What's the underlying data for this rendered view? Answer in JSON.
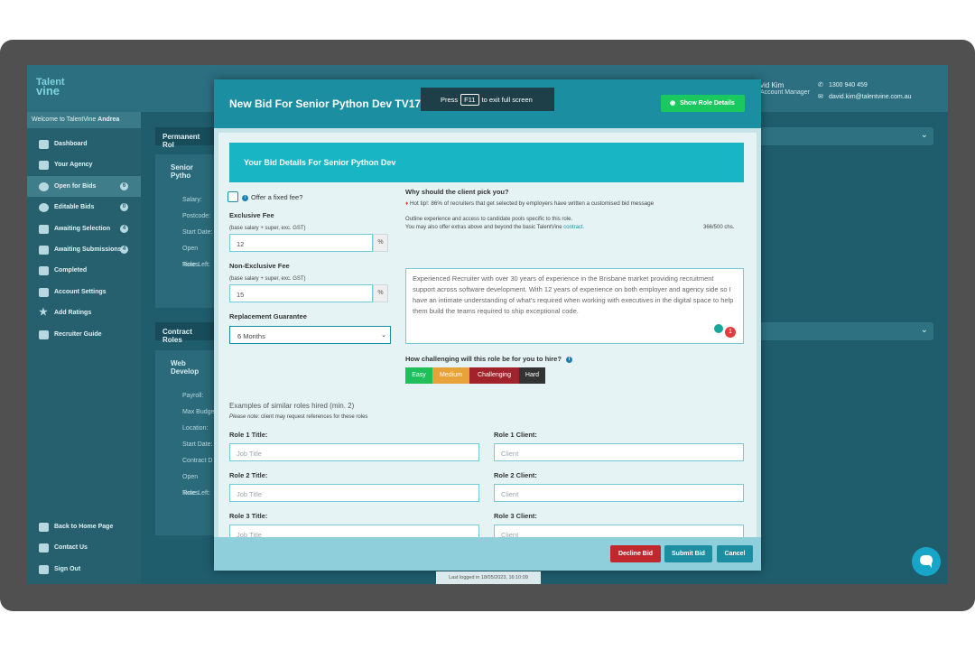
{
  "app": {
    "logo_line1": "Talent",
    "logo_line2": "vine"
  },
  "header": {
    "account_name": "vid Kim",
    "account_role": "Account Manager",
    "phone": "1300 940 459",
    "email": "david.kim@talentvine.com.au"
  },
  "sidebar": {
    "welcome_prefix": "Welcome to TalentVine",
    "welcome_name": "Andrea",
    "items": [
      {
        "label": "Dashboard",
        "badge": ""
      },
      {
        "label": "Your Agency",
        "badge": ""
      },
      {
        "label": "Open for Bids",
        "badge": "6"
      },
      {
        "label": "Editable Bids",
        "badge": "0"
      },
      {
        "label": "Awaiting Selection",
        "badge": "4"
      },
      {
        "label": "Awaiting Submissions",
        "badge": "4"
      },
      {
        "label": "Completed",
        "badge": ""
      },
      {
        "label": "Account Settings",
        "badge": ""
      },
      {
        "label": "Add Ratings",
        "badge": ""
      },
      {
        "label": "Recruiter Guide",
        "badge": ""
      }
    ],
    "bottom_items": [
      {
        "label": "Back to Home Page"
      },
      {
        "label": "Contact Us"
      },
      {
        "label": "Sign Out"
      }
    ]
  },
  "background": {
    "permanent_title": "Permanent Rol",
    "permanent_card_title": "Senior Pytho",
    "permanent_rows": [
      "Salary:",
      "Postcode:",
      "Start Date:",
      "Open Roles",
      "Time Left:"
    ],
    "contract_title": "Contract Roles",
    "contract_card_title": "Web Develop",
    "contract_rows": [
      "Payroll:",
      "Max Budge",
      "Location:",
      "Start Date:",
      "Contract D",
      "Open Roles",
      "Time Left:"
    ]
  },
  "modal": {
    "title": "New Bid For Senior Python Dev TV1729",
    "fullscreen_prefix": "Press",
    "fullscreen_key": "F11",
    "fullscreen_suffix": "to exit full screen",
    "show_role_details": "Show Role Details",
    "banner": "Your Bid Details For Senior Python Dev",
    "fixed_fee_label": "Offer a fixed fee?",
    "exclusive_fee_label": "Exclusive Fee",
    "exclusive_fee_note": "(base salary + super, exc. GST)",
    "exclusive_fee_value": "12",
    "nonexclusive_fee_label": "Non-Exclusive Fee",
    "nonexclusive_fee_note": "(base salary + super, exc. GST)",
    "nonexclusive_fee_value": "15",
    "percent": "%",
    "replacement_label": "Replacement Guarantee",
    "replacement_value": "6 Months",
    "why_label": "Why should the client pick you?",
    "hot_tip": "Hot tip!: 86% of recruiters that get selected by employers have written a customised bid message",
    "outline_note": "Outline experience and access to candidate pools specific to this role.",
    "extras_note": "You may also offer extras above and beyond the basic TalentVine",
    "contract_link": "contract.",
    "char_count": "366/500 chs.",
    "message": "Experienced Recruiter with over 30 years of experience in the Brisbane market providing recruitment support across software development. With 12 years of experience on both employer and agency side so I have an intimate understanding of what's required when working with executives in the digital space to help them build the teams required to ship exceptional code.",
    "challenge_label": "How challenging will this role be for you to hire?",
    "difficulty": [
      {
        "label": "Easy",
        "color": "#1fbf5b"
      },
      {
        "label": "Medium",
        "color": "#e8a23a"
      },
      {
        "label": "Challenging",
        "color": "#a0222a"
      },
      {
        "label": "Hard",
        "color": "#333333"
      }
    ],
    "examples_label": "Examples of similar roles hired (min. 2)",
    "examples_note_bold": "Please note:",
    "examples_note": "client may request references for these roles",
    "roles": [
      {
        "title_label": "Role 1 Title:",
        "client_label": "Role 1 Client:",
        "title_placeholder": "Job Title",
        "client_placeholder": "Client"
      },
      {
        "title_label": "Role 2 Title:",
        "client_label": "Role 2 Client:",
        "title_placeholder": "Job Title",
        "client_placeholder": "Client"
      },
      {
        "title_label": "Role 3 Title:",
        "client_label": "Role 3 Client:",
        "title_placeholder": "Job Title",
        "client_placeholder": "Client"
      }
    ],
    "decline_label": "Decline Bid",
    "submit_label": "Submit Bid",
    "cancel_label": "Cancel"
  },
  "footer": {
    "last_logged": "Last logged in 18/05/2023, 16:10:09"
  },
  "colors": {
    "accent": "#1c8ea2",
    "banner": "#18b6c4",
    "decline": "#c0282d",
    "submit": "#1b8ea2",
    "show_role": "#19c85e"
  }
}
